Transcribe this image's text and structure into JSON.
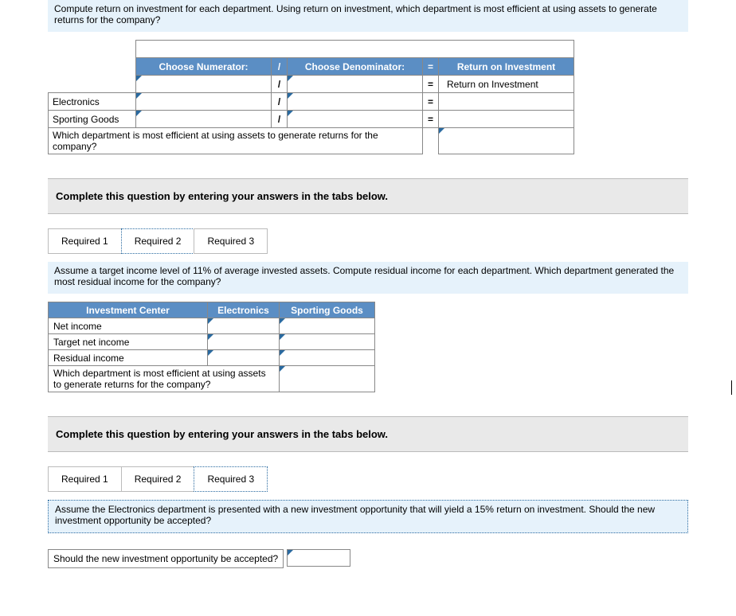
{
  "q1": {
    "text": "Compute return on investment for each department. Using return on investment, which department is most efficient at using assets to generate returns for the company?",
    "tableTitle": "Return on Investment",
    "numHeader": "Choose Numerator:",
    "denHeader": "Choose Denominator:",
    "resultHeader": "Return on Investment",
    "resultLabel": "Return on Investment",
    "rows": [
      "Electronics",
      "Sporting Goods"
    ],
    "footerQ": "Which department is most efficient at using assets to generate returns for the company?",
    "slash": "/",
    "eq": "="
  },
  "instr": "Complete this question by entering your answers in the tabs below.",
  "tabs": [
    "Required 1",
    "Required 2",
    "Required 3"
  ],
  "q2": {
    "text": "Assume a target income level of 11% of average invested assets. Compute residual income for each department. Which department generated the most residual income for the company?",
    "col1": "Investment Center",
    "col2": "Electronics",
    "col3": "Sporting Goods",
    "rows": [
      "Net income",
      "Target net income",
      "Residual income"
    ],
    "footerQ": "Which department is most efficient at using assets to generate returns for the company?"
  },
  "q3": {
    "text": "Assume the Electronics department is presented with a new investment opportunity that will yield a 15% return on investment. Should the new investment opportunity be accepted?",
    "footerQ": "Should the new investment opportunity be accepted?"
  }
}
